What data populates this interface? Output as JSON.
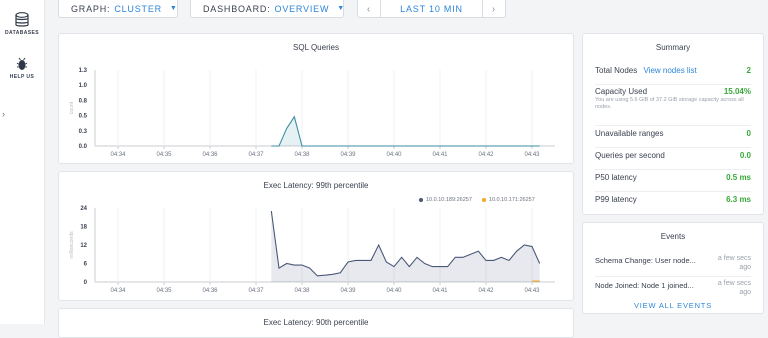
{
  "sidebar": {
    "items": [
      {
        "label": "DATABASES",
        "icon": "database-icon"
      },
      {
        "label": "HELP US",
        "icon": "bug-icon"
      }
    ],
    "collapse_glyph": "›"
  },
  "toolbar": {
    "graph_label": "GRAPH:",
    "graph_value": "CLUSTER",
    "dashboard_label": "DASHBOARD:",
    "dashboard_value": "OVERVIEW",
    "prev_glyph": "‹",
    "time_range": "LAST 10 MIN",
    "next_glyph": "›"
  },
  "charts": {
    "sql": {
      "title": "SQL Queries",
      "ylabel": "count",
      "yticks": [
        "1.3",
        "1.0",
        "0.8",
        "0.5",
        "0.3",
        "0.0"
      ],
      "xticks": [
        "04:34",
        "04:35",
        "04:36",
        "04:37",
        "04:38",
        "04:39",
        "04:40",
        "04:41",
        "04:42",
        "04:43"
      ]
    },
    "latency99": {
      "title": "Exec Latency: 99th percentile",
      "ylabel": "milliseconds",
      "yticks": [
        "24",
        "18",
        "12",
        "6",
        "0"
      ],
      "xticks": [
        "04:34",
        "04:35",
        "04:36",
        "04:37",
        "04:38",
        "04:39",
        "04:40",
        "04:41",
        "04:42",
        "04:43"
      ],
      "legend": [
        {
          "name": "10.0.10.189:26257",
          "color": "#4a5878"
        },
        {
          "name": "10.0.10.171:26257",
          "color": "#f5a623"
        }
      ]
    },
    "latency90": {
      "title": "Exec Latency: 90th percentile"
    }
  },
  "chart_data": [
    {
      "type": "area",
      "title": "SQL Queries",
      "ylabel": "count",
      "ylim": [
        0,
        1.3
      ],
      "x": [
        "04:37:20",
        "04:37:30",
        "04:37:40",
        "04:37:50",
        "04:38:00",
        "04:38:10",
        "04:38:20",
        "04:38:40",
        "04:39:00",
        "04:39:30",
        "04:40:00",
        "04:40:30",
        "04:41:00",
        "04:41:30",
        "04:42:00",
        "04:42:30",
        "04:43:00",
        "04:43:10"
      ],
      "series": [
        {
          "name": "",
          "color": "#3a8fa0",
          "values": [
            0,
            0,
            0.3,
            0.5,
            0,
            0,
            0,
            0,
            0,
            0,
            0,
            0,
            0,
            0,
            0,
            0,
            0,
            0
          ]
        }
      ]
    },
    {
      "type": "area",
      "title": "Exec Latency: 99th percentile",
      "ylabel": "milliseconds",
      "ylim": [
        0,
        24
      ],
      "x": [
        "04:37:20",
        "04:37:30",
        "04:37:40",
        "04:37:50",
        "04:38:00",
        "04:38:10",
        "04:38:20",
        "04:38:30",
        "04:38:40",
        "04:38:50",
        "04:39:00",
        "04:39:10",
        "04:39:20",
        "04:39:30",
        "04:39:40",
        "04:39:50",
        "04:40:00",
        "04:40:10",
        "04:40:20",
        "04:40:30",
        "04:40:40",
        "04:40:50",
        "04:41:00",
        "04:41:10",
        "04:41:20",
        "04:41:30",
        "04:41:40",
        "04:41:50",
        "04:42:00",
        "04:42:10",
        "04:42:20",
        "04:42:30",
        "04:42:40",
        "04:42:50",
        "04:43:00",
        "04:43:10"
      ],
      "series": [
        {
          "name": "10.0.10.189:26257",
          "color": "#4a5878",
          "values": [
            23,
            4.5,
            6,
            5.5,
            5.5,
            4.5,
            2,
            2.2,
            2.5,
            3,
            6.5,
            7,
            7,
            7,
            12,
            6.5,
            5,
            8,
            5,
            8,
            6,
            5,
            5,
            5,
            8,
            8,
            9,
            10,
            7,
            7,
            8,
            7,
            10,
            12,
            11.5,
            6
          ]
        },
        {
          "name": "10.0.10.171:26257",
          "color": "#f5a623",
          "values": [
            null,
            null,
            null,
            null,
            null,
            null,
            null,
            null,
            null,
            null,
            null,
            null,
            null,
            null,
            null,
            null,
            null,
            null,
            null,
            null,
            null,
            null,
            null,
            null,
            null,
            null,
            null,
            null,
            null,
            null,
            null,
            null,
            null,
            null,
            0.3,
            0.3
          ]
        }
      ]
    }
  ],
  "summary": {
    "title": "Summary",
    "total_nodes_label": "Total Nodes",
    "view_nodes_link": "View nodes list",
    "total_nodes_value": "2",
    "capacity_label": "Capacity Used",
    "capacity_value": "15.04%",
    "capacity_sub": "You are using 5.6 GiB of 37.2 GiB storage capacity across all nodes.",
    "unavailable_label": "Unavailable ranges",
    "unavailable_value": "0",
    "qps_label": "Queries per second",
    "qps_value": "0.0",
    "p50_label": "P50 latency",
    "p50_value": "0.5 ms",
    "p99_label": "P99 latency",
    "p99_value": "6.3 ms"
  },
  "events": {
    "title": "Events",
    "items": [
      {
        "text": "Schema Change: User node...",
        "time": "a few secs ago"
      },
      {
        "text": "Node Joined: Node 1 joined...",
        "time": "a few secs ago"
      }
    ],
    "view_all": "VIEW ALL EVENTS"
  },
  "colors": {
    "accent": "#2e86d8",
    "good": "#37a838",
    "series_primary": "#4a5878",
    "series_secondary": "#f5a623",
    "sql_series": "#3a8fa0"
  }
}
